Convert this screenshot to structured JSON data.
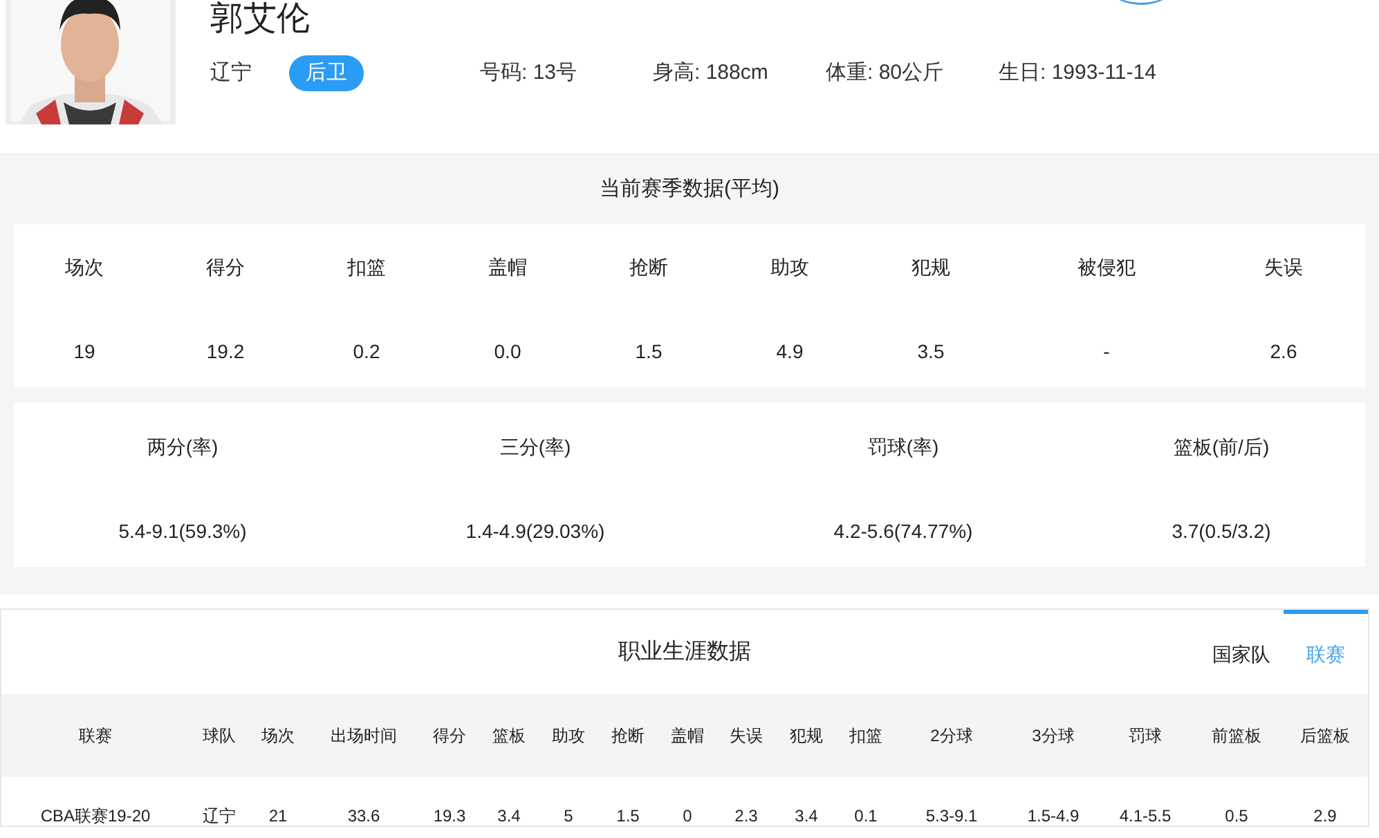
{
  "player": {
    "name": "郭艾伦",
    "team": "辽宁",
    "position": "后卫",
    "info": [
      "号码: 13号",
      "身高: 188cm",
      "体重: 80公斤",
      "生日: 1993-11-14"
    ]
  },
  "season": {
    "title": "当前赛季数据(平均)",
    "stats": [
      {
        "label": "场次",
        "value": "19"
      },
      {
        "label": "得分",
        "value": "19.2"
      },
      {
        "label": "扣篮",
        "value": "0.2"
      },
      {
        "label": "盖帽",
        "value": "0.0"
      },
      {
        "label": "抢断",
        "value": "1.5"
      },
      {
        "label": "助攻",
        "value": "4.9"
      },
      {
        "label": "犯规",
        "value": "3.5"
      },
      {
        "label": "被侵犯",
        "value": "-"
      },
      {
        "label": "失误",
        "value": "2.6"
      }
    ],
    "shooting": [
      {
        "label": "两分(率)",
        "value": "5.4-9.1(59.3%)"
      },
      {
        "label": "三分(率)",
        "value": "1.4-4.9(29.03%)"
      },
      {
        "label": "罚球(率)",
        "value": "4.2-5.6(74.77%)"
      },
      {
        "label": "篮板(前/后)",
        "value": "3.7(0.5/3.2)"
      }
    ]
  },
  "career": {
    "title": "职业生涯数据",
    "tabs": [
      {
        "label": "国家队",
        "selected": false
      },
      {
        "label": "联赛",
        "selected": true
      }
    ],
    "columns": [
      "联赛",
      "球队",
      "场次",
      "出场时间",
      "得分",
      "篮板",
      "助攻",
      "抢断",
      "盖帽",
      "失误",
      "犯规",
      "扣篮",
      "2分球",
      "3分球",
      "罚球",
      "前篮板",
      "后篮板"
    ],
    "rows": [
      [
        "CBA联赛19-20",
        "辽宁",
        "21",
        "33.6",
        "19.3",
        "3.4",
        "5",
        "1.5",
        "0",
        "2.3",
        "3.4",
        "0.1",
        "5.3-9.1",
        "1.5-4.9",
        "4.1-5.5",
        "0.5",
        "2.9"
      ]
    ]
  }
}
